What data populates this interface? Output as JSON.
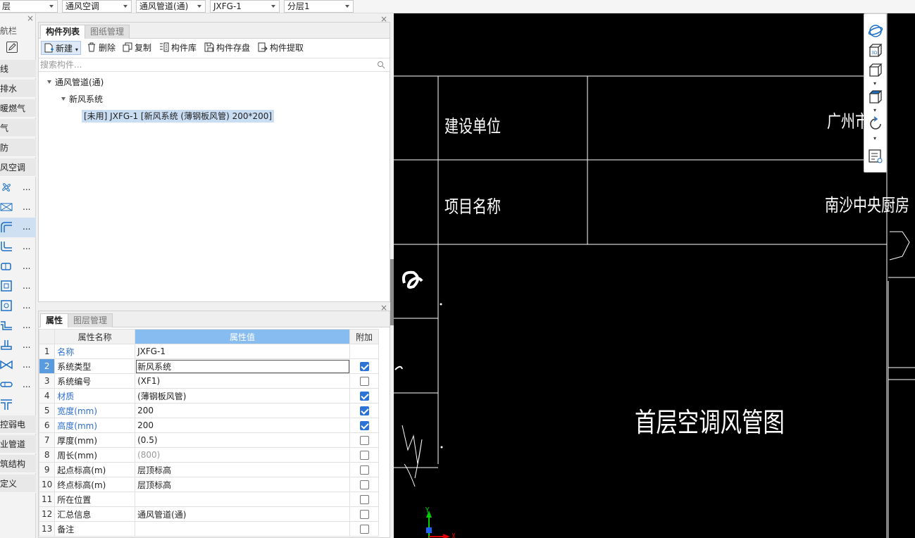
{
  "top_selectors": [
    {
      "label": "层"
    },
    {
      "label": "通风空调"
    },
    {
      "label": "通风管道(通)"
    },
    {
      "label": "JXFG-1"
    },
    {
      "label": "分层1"
    }
  ],
  "nav": {
    "title": "导航栏",
    "items": [
      "线",
      "排水",
      "暖燃气",
      "气",
      "防",
      "风空调"
    ],
    "bottom_items": [
      "控弱电",
      "业管道",
      "筑结构",
      "定义"
    ],
    "icons": [
      "fan-icon",
      "air-valve-icon",
      "duct-icon",
      "duct-fitting-icon",
      "duct-component-icon",
      "air-outlet-icon",
      "damper-icon",
      "duct-offset-icon",
      "duct-riser-icon",
      "valve-icon",
      "pipe-connector-icon",
      "tee-icon"
    ],
    "more_label": "..."
  },
  "component_panel": {
    "tabs": [
      "构件列表",
      "图纸管理"
    ],
    "toolbar": {
      "new": "新建",
      "delete": "删除",
      "copy": "复制",
      "library": "构件库",
      "save": "构件存盘",
      "extract": "构件提取"
    },
    "search_placeholder": "搜索构件...",
    "tree": {
      "root": "通风管道(通)",
      "child": "新风系统",
      "leaf": "[未用] JXFG-1 [新风系统 (薄钢板风管) 200*200]"
    }
  },
  "property_panel": {
    "tabs": [
      "属性",
      "图层管理"
    ],
    "headers": {
      "name": "属性名称",
      "value": "属性值",
      "extra": "附加"
    },
    "rows": [
      {
        "n": "1",
        "name": "名称",
        "value": "JXFG-1",
        "blue": true,
        "check": null
      },
      {
        "n": "2",
        "name": "系统类型",
        "value": "新风系统",
        "blue": false,
        "check": true
      },
      {
        "n": "3",
        "name": "系统编号",
        "value": "(XF1)",
        "blue": false,
        "check": false
      },
      {
        "n": "4",
        "name": "材质",
        "value": "(薄钢板风管)",
        "blue": true,
        "check": true
      },
      {
        "n": "5",
        "name": "宽度(mm)",
        "value": "200",
        "blue": true,
        "check": true
      },
      {
        "n": "6",
        "name": "高度(mm)",
        "value": "200",
        "blue": true,
        "check": true
      },
      {
        "n": "7",
        "name": "厚度(mm)",
        "value": "(0.5)",
        "blue": false,
        "check": false
      },
      {
        "n": "8",
        "name": "周长(mm)",
        "value": "(800)",
        "blue": false,
        "check": false
      },
      {
        "n": "9",
        "name": "起点标高(m)",
        "value": "层顶标高",
        "blue": false,
        "check": false
      },
      {
        "n": "10",
        "name": "终点标高(m)",
        "value": "层顶标高",
        "blue": false,
        "check": false
      },
      {
        "n": "11",
        "name": "所在位置",
        "value": "",
        "blue": false,
        "check": false
      },
      {
        "n": "12",
        "name": "汇总信息",
        "value": "通风管道(通)",
        "blue": false,
        "check": false
      },
      {
        "n": "13",
        "name": "备注",
        "value": "",
        "blue": false,
        "check": false
      }
    ]
  },
  "drawing": {
    "label_owner": "建设单位",
    "value_owner": "广州市",
    "label_project": "项目名称",
    "value_project": "南沙中央厨房",
    "title": "首层空调风管图",
    "axis_y": "Y",
    "axis_x": "X",
    "line_color": "#ffffff",
    "background": "#000000"
  },
  "view_tools": [
    "orbit-icon",
    "3d-view-icon",
    "cube-view-icon",
    "top-view-icon",
    "rotate-icon",
    "drawing-view-icon"
  ]
}
